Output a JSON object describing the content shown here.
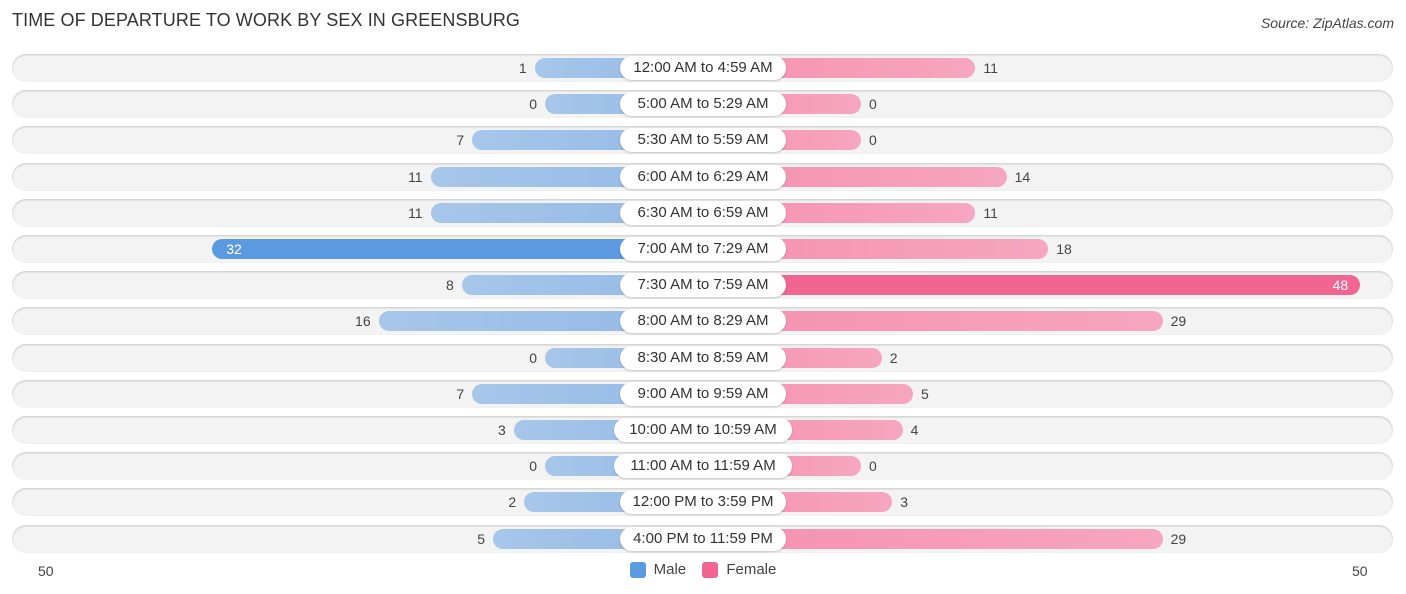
{
  "header": {
    "title": "TIME OF DEPARTURE TO WORK BY SEX IN GREENSBURG",
    "source": "Source: ZipAtlas.com"
  },
  "colors": {
    "male_light": "#a7c6ea",
    "male_dark": "#5b9ae0",
    "female_light": "#f6a6c0",
    "female_dark": "#f06591"
  },
  "chart_data": {
    "type": "bar",
    "orientation": "horizontal-diverging",
    "title": "TIME OF DEPARTURE TO WORK BY SEX IN GREENSBURG",
    "categories": [
      "12:00 AM to 4:59 AM",
      "5:00 AM to 5:29 AM",
      "5:30 AM to 5:59 AM",
      "6:00 AM to 6:29 AM",
      "6:30 AM to 6:59 AM",
      "7:00 AM to 7:29 AM",
      "7:30 AM to 7:59 AM",
      "8:00 AM to 8:29 AM",
      "8:30 AM to 8:59 AM",
      "9:00 AM to 9:59 AM",
      "10:00 AM to 10:59 AM",
      "11:00 AM to 11:59 AM",
      "12:00 PM to 3:59 PM",
      "4:00 PM to 11:59 PM"
    ],
    "series": [
      {
        "name": "Male",
        "values": [
          1,
          0,
          7,
          11,
          11,
          32,
          8,
          16,
          0,
          7,
          3,
          0,
          2,
          5
        ]
      },
      {
        "name": "Female",
        "values": [
          11,
          0,
          0,
          14,
          11,
          18,
          48,
          29,
          2,
          5,
          4,
          0,
          3,
          29
        ]
      }
    ],
    "axis": {
      "left_label": "50",
      "right_label": "50",
      "max": 50
    },
    "legend": {
      "position": "bottom-center",
      "entries": [
        "Male",
        "Female"
      ]
    }
  }
}
